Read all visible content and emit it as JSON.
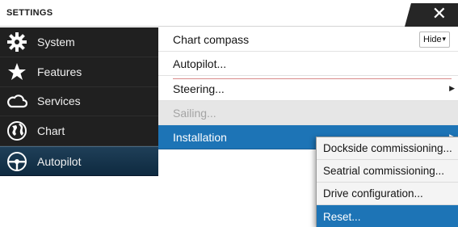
{
  "window": {
    "title": "SETTINGS",
    "close_label": "✕"
  },
  "sidebar": {
    "items": [
      {
        "label": "System",
        "icon": "gear-icon"
      },
      {
        "label": "Features",
        "icon": "star-icon"
      },
      {
        "label": "Services",
        "icon": "cloud-icon"
      },
      {
        "label": "Chart",
        "icon": "chart-icon"
      },
      {
        "label": "Autopilot",
        "icon": "steering-wheel-icon",
        "selected": true
      }
    ]
  },
  "main": {
    "rows": [
      {
        "label": "Chart compass",
        "control": {
          "value": "Hide",
          "caret": "▾"
        }
      },
      {
        "label": "Autopilot..."
      },
      {
        "label": "Steering...",
        "arrow": "▶"
      },
      {
        "label": "Sailing...",
        "disabled": true
      },
      {
        "label": "Installation",
        "arrow": "▶",
        "active": true
      }
    ]
  },
  "popup": {
    "items": [
      {
        "label": "Dockside commissioning..."
      },
      {
        "label": "Seatrial commissioning..."
      },
      {
        "label": "Drive configuration..."
      },
      {
        "label": "Reset...",
        "highlight": true
      }
    ]
  },
  "colors": {
    "accent": "#1d74b6",
    "sidebar_bg": "#202020",
    "sidebar_selected": "#0e2a40"
  }
}
